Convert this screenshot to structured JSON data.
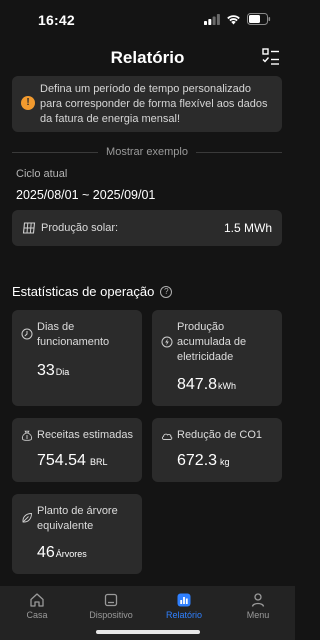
{
  "status": {
    "time": "16:42"
  },
  "header": {
    "title": "Relatório"
  },
  "notice": {
    "text": "Defina um período de tempo personalizado para corresponder de forma flexível aos dados da fatura de energia mensal!"
  },
  "example": {
    "label": "Mostrar exemplo"
  },
  "cycle": {
    "label": "Ciclo atual",
    "range": "2025/08/01 ~ 2025/09/01"
  },
  "solar": {
    "label": "Produção solar:",
    "value": "1.5 MWh"
  },
  "stats": {
    "title": "Estatísticas de operação",
    "cards": [
      {
        "label": "Dias de funcionamento",
        "value": "33",
        "unit": "Dia"
      },
      {
        "label": "Produção acumulada de eletricidade",
        "value": "847.8",
        "unit": "kWh"
      },
      {
        "label": "Receitas estimadas",
        "value": "754.54",
        "unit": "BRL"
      },
      {
        "label": "Redução de CO1",
        "value": "672.3",
        "unit": "kg"
      },
      {
        "label": "Planto de árvore equivalente",
        "value": "46",
        "unit": "Árvores"
      }
    ]
  },
  "tabs": [
    {
      "label": "Casa",
      "icon": "home-icon",
      "active": false
    },
    {
      "label": "Dispositivo",
      "icon": "device-icon",
      "active": false
    },
    {
      "label": "Relatório",
      "icon": "report-icon",
      "active": true
    },
    {
      "label": "Menu",
      "icon": "person-icon",
      "active": false
    }
  ],
  "colors": {
    "background": "#141414",
    "card": "#2b2b2b",
    "accent": "#2f80ff",
    "warning": "#f29a2e",
    "tabbar": "#232323"
  }
}
